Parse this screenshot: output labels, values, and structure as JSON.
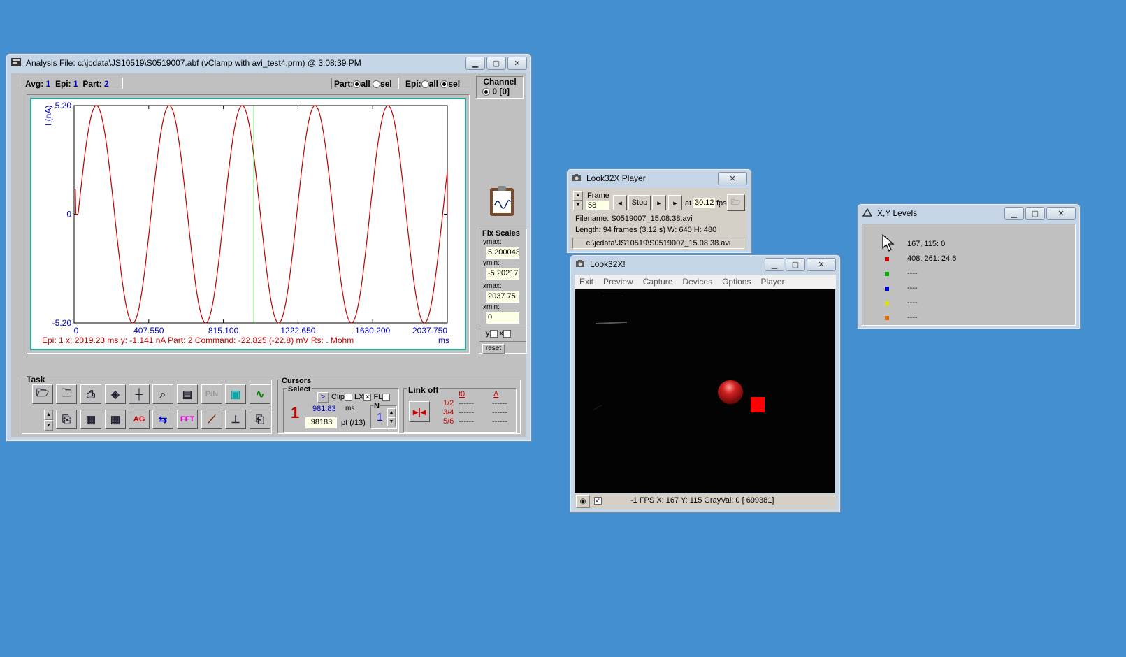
{
  "analysis": {
    "title": "Analysis  File: c:\\jcdata\\JS10519\\S0519007.abf (vClamp with avi_test4.prm) @ 3:08:39 PM",
    "avg_label": "Avg:",
    "avg_value": "1",
    "epi_label": "Epi:",
    "epi_value": "1",
    "part_label": "Part:",
    "part_value": "2",
    "part_sel_label": "Part:",
    "epi_sel_label": "Epi:",
    "all_label": "all",
    "sel_label": "sel",
    "channel_label": "Channel",
    "channel_value": "0  [0]",
    "status_line": "Epi: 1  x: 2019.23 ms   y: -1.141 nA  Part:  2  Command: -22.825 (-22.8) mV  Rs: . Mohm",
    "x_unit": "ms",
    "fix_scales_label": "Fix Scales",
    "ymax_label": "ymax:",
    "ymax_value": "5.200043",
    "ymin_label": "ymin:",
    "ymin_value": "-5.20217",
    "xmax_label": "xmax:",
    "xmax_value": "2037.75",
    "xmin_label": "xmin:",
    "xmin_value": "0",
    "y_chk_label": "y",
    "x_chk_label": "x",
    "reset_label": "reset",
    "task_label": "Task",
    "pn_label": "P/N",
    "ag_label": "AG",
    "fft_label": "FFT",
    "cursors_label": "Cursors",
    "select_label": "Select",
    "select_btn": ">",
    "clip_label": "Clip",
    "lx_label": "LX",
    "fl_label": "FL",
    "cursor_num": "1",
    "cursor_ms_value": "981.83",
    "ms_label": "ms",
    "cursor_pt_value": "98183",
    "pt_label": "pt (/13)",
    "n_label": "N",
    "n_value": "1",
    "link_label": "Link off",
    "t0_label": "t0",
    "delta_label": "Δ",
    "pairs": [
      {
        "label": "1/2",
        "t0": "------",
        "d": "------"
      },
      {
        "label": "3/4",
        "t0": "------",
        "d": "------"
      },
      {
        "label": "5/6",
        "t0": "------",
        "d": "------"
      }
    ]
  },
  "chart_data": {
    "type": "line",
    "title": "",
    "ylabel": "I (nA)",
    "xlabel": "ms",
    "xlim": [
      0,
      2037.75
    ],
    "ylim": [
      -5.2,
      5.2
    ],
    "x_ticks": [
      "0",
      "407.550",
      "815.100",
      "1222.650",
      "1630.200",
      "2037.750"
    ],
    "y_ticks": [
      "5.20",
      "0",
      "-5.20"
    ],
    "series": [
      {
        "color": "#c00000",
        "shape": "sine",
        "amplitude": 5.2,
        "period_ms": 398,
        "onset_ms": 22,
        "baseline_start": 1.2
      }
    ],
    "cursor_x": 981.83,
    "cursor_color": "#008000",
    "grid": false
  },
  "player": {
    "title": "Look32X Player",
    "frame_label": "Frame",
    "frame_value": "58",
    "stop_label": "Stop",
    "at_label": "at",
    "fps_value": "30.12",
    "fps_label": "fps",
    "filename_line": "Filename:  S0519007_15.08.38.avi",
    "length_line": "Length:  94 frames (3.12 s)    W:  640 H: 480",
    "path_line": "c:\\jcdata\\JS10519\\S0519007_15.08.38.avi"
  },
  "look": {
    "title": "Look32X!",
    "menu": [
      "Exit",
      "Preview",
      "Capture",
      "Devices",
      "Options",
      "Player"
    ],
    "status": "-1 FPS   X:  167  Y:  115   GrayVal: 0  [ 699381]"
  },
  "xy": {
    "title": "X,Y Levels",
    "rows": [
      {
        "color": "",
        "text": "167,  115:  0"
      },
      {
        "color": "#cc0000",
        "text": "408,  261: 24.6"
      },
      {
        "color": "#00b000",
        "text": "----"
      },
      {
        "color": "#0000cc",
        "text": "----"
      },
      {
        "color": "#e0e000",
        "text": "----"
      },
      {
        "color": "#e07000",
        "text": "----"
      }
    ]
  }
}
